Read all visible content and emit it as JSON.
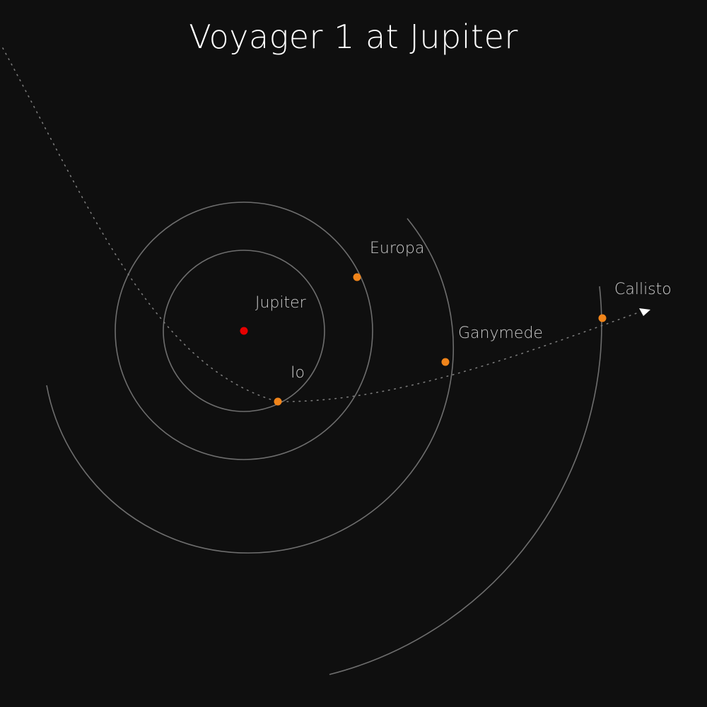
{
  "title": "Voyager 1 at Jupiter",
  "colors": {
    "background": "#0f0f0f",
    "orbit": "#6e6e6e",
    "trajectory": "#7a7a7a",
    "planet": "#e60000",
    "moon": "#f0841a",
    "probe": "#ffffff",
    "label": "#c9c9c9"
  },
  "planet": {
    "label": "Jupiter",
    "icon": "planet-dot"
  },
  "moons": [
    {
      "id": "io",
      "label": "Io"
    },
    {
      "id": "europa",
      "label": "Europa"
    },
    {
      "id": "ganymede",
      "label": "Ganymede"
    },
    {
      "id": "callisto",
      "label": "Callisto"
    }
  ],
  "probe": {
    "icon": "arrowhead-icon"
  }
}
